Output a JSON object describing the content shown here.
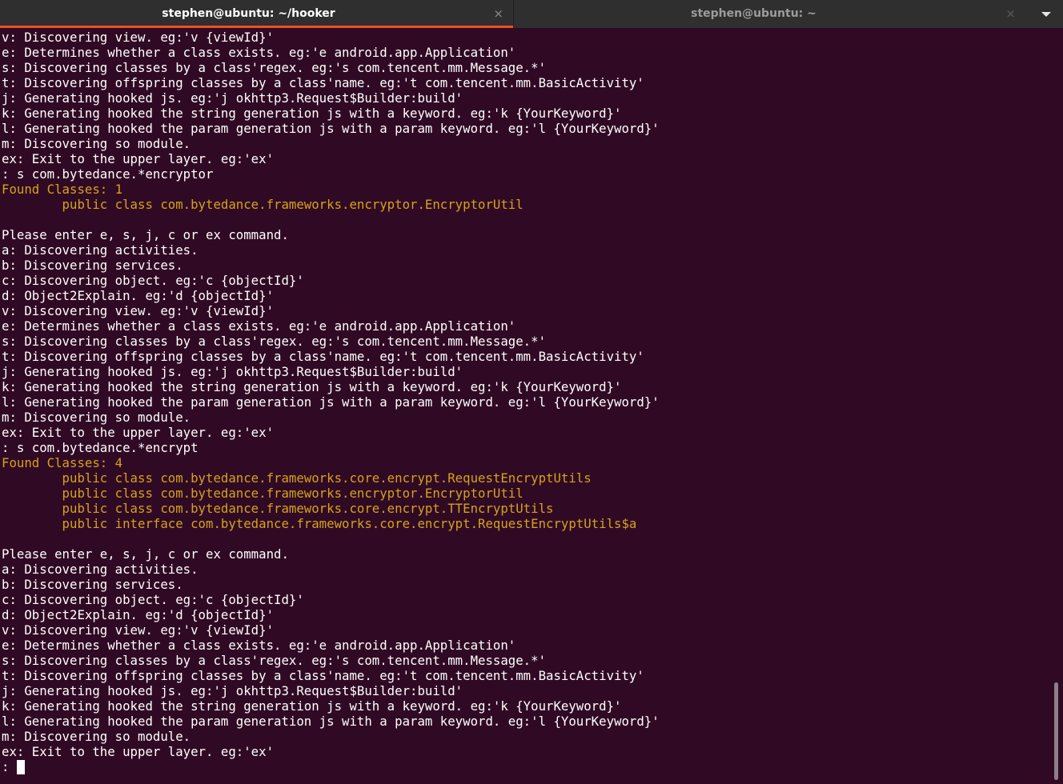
{
  "tabs": [
    {
      "title": "stephen@ubuntu: ~/hooker",
      "close": "×",
      "active": true
    },
    {
      "title": "stephen@ubuntu: ~",
      "close": "×",
      "active": false
    }
  ],
  "colors": {
    "background": "#300a24",
    "text": "#ffffff",
    "highlight": "#d4a31b",
    "active_tab_indicator": "#e95420"
  },
  "terminal": {
    "lines": [
      {
        "text": "v: Discovering view. eg:'v {viewId}'"
      },
      {
        "text": "e: Determines whether a class exists. eg:'e android.app.Application'"
      },
      {
        "text": "s: Discovering classes by a class'regex. eg:'s com.tencent.mm.Message.*'"
      },
      {
        "text": "t: Discovering offspring classes by a class'name. eg:'t com.tencent.mm.BasicActivity'"
      },
      {
        "text": "j: Generating hooked js. eg:'j okhttp3.Request$Builder:build'"
      },
      {
        "text": "k: Generating hooked the string generation js with a keyword. eg:'k {YourKeyword}'"
      },
      {
        "text": "l: Generating hooked the param generation js with a param keyword. eg:'l {YourKeyword}'"
      },
      {
        "text": "m: Discovering so module."
      },
      {
        "text": "ex: Exit to the upper layer. eg:'ex'"
      },
      {
        "text": ": s com.bytedance.*encryptor"
      },
      {
        "text": "Found Classes: 1",
        "hl": true
      },
      {
        "text": "        public class com.bytedance.frameworks.encryptor.EncryptorUtil",
        "hl": true
      },
      {
        "text": ""
      },
      {
        "text": "Please enter e, s, j, c or ex command."
      },
      {
        "text": "a: Discovering activities."
      },
      {
        "text": "b: Discovering services."
      },
      {
        "text": "c: Discovering object. eg:'c {objectId}'"
      },
      {
        "text": "d: Object2Explain. eg:'d {objectId}'"
      },
      {
        "text": "v: Discovering view. eg:'v {viewId}'"
      },
      {
        "text": "e: Determines whether a class exists. eg:'e android.app.Application'"
      },
      {
        "text": "s: Discovering classes by a class'regex. eg:'s com.tencent.mm.Message.*'"
      },
      {
        "text": "t: Discovering offspring classes by a class'name. eg:'t com.tencent.mm.BasicActivity'"
      },
      {
        "text": "j: Generating hooked js. eg:'j okhttp3.Request$Builder:build'"
      },
      {
        "text": "k: Generating hooked the string generation js with a keyword. eg:'k {YourKeyword}'"
      },
      {
        "text": "l: Generating hooked the param generation js with a param keyword. eg:'l {YourKeyword}'"
      },
      {
        "text": "m: Discovering so module."
      },
      {
        "text": "ex: Exit to the upper layer. eg:'ex'"
      },
      {
        "text": ": s com.bytedance.*encrypt"
      },
      {
        "text": "Found Classes: 4",
        "hl": true
      },
      {
        "text": "        public class com.bytedance.frameworks.core.encrypt.RequestEncryptUtils",
        "hl": true
      },
      {
        "text": "        public class com.bytedance.frameworks.encryptor.EncryptorUtil",
        "hl": true
      },
      {
        "text": "        public class com.bytedance.frameworks.core.encrypt.TTEncryptUtils",
        "hl": true
      },
      {
        "text": "        public interface com.bytedance.frameworks.core.encrypt.RequestEncryptUtils$a",
        "hl": true
      },
      {
        "text": ""
      },
      {
        "text": "Please enter e, s, j, c or ex command."
      },
      {
        "text": "a: Discovering activities."
      },
      {
        "text": "b: Discovering services."
      },
      {
        "text": "c: Discovering object. eg:'c {objectId}'"
      },
      {
        "text": "d: Object2Explain. eg:'d {objectId}'"
      },
      {
        "text": "v: Discovering view. eg:'v {viewId}'"
      },
      {
        "text": "e: Determines whether a class exists. eg:'e android.app.Application'"
      },
      {
        "text": "s: Discovering classes by a class'regex. eg:'s com.tencent.mm.Message.*'"
      },
      {
        "text": "t: Discovering offspring classes by a class'name. eg:'t com.tencent.mm.BasicActivity'"
      },
      {
        "text": "j: Generating hooked js. eg:'j okhttp3.Request$Builder:build'"
      },
      {
        "text": "k: Generating hooked the string generation js with a keyword. eg:'k {YourKeyword}'"
      },
      {
        "text": "l: Generating hooked the param generation js with a param keyword. eg:'l {YourKeyword}'"
      },
      {
        "text": "m: Discovering so module."
      },
      {
        "text": "ex: Exit to the upper layer. eg:'ex'"
      }
    ],
    "prompt": ": "
  }
}
